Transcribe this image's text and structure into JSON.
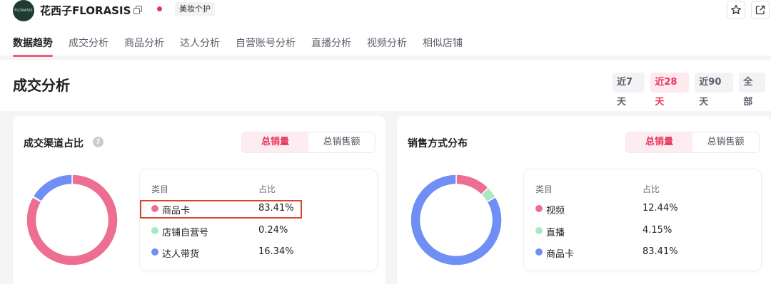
{
  "header": {
    "logo_text": "FLORASIS",
    "shop_name": "花西子FLORASIS",
    "category_badge": "美妆个护",
    "icons": {
      "copy": "copy-icon",
      "live": "live-dot",
      "star": "star-icon",
      "share": "share-icon"
    }
  },
  "tabs": [
    {
      "label": "数据趋势",
      "active": true
    },
    {
      "label": "成交分析"
    },
    {
      "label": "商品分析"
    },
    {
      "label": "达人分析"
    },
    {
      "label": "自营账号分析"
    },
    {
      "label": "直播分析"
    },
    {
      "label": "视频分析"
    },
    {
      "label": "相似店铺"
    }
  ],
  "section": {
    "title": "成交分析",
    "ranges": [
      {
        "label": "近7天"
      },
      {
        "label": "近28天",
        "active": true
      },
      {
        "label": "近90天"
      },
      {
        "label": "全部"
      }
    ]
  },
  "channel_card": {
    "title": "成交渠道占比",
    "help_icon": "?",
    "toggle": [
      {
        "label": "总销量",
        "active": true
      },
      {
        "label": "总销售额"
      }
    ],
    "col_category": "类目",
    "col_share": "占比",
    "rows": [
      {
        "name": "商品卡",
        "share": "83.41%",
        "color": "#ed6e91",
        "highlighted": true
      },
      {
        "name": "店铺自营号",
        "share": "0.24%",
        "color": "#a9e8c5"
      },
      {
        "name": "达人带货",
        "share": "16.34%",
        "color": "#6f8ff5"
      }
    ]
  },
  "method_card": {
    "title": "销售方式分布",
    "toggle": [
      {
        "label": "总销量",
        "active": true
      },
      {
        "label": "总销售额"
      }
    ],
    "col_category": "类目",
    "col_share": "占比",
    "rows": [
      {
        "name": "视频",
        "share": "12.44%",
        "color": "#ed6e91"
      },
      {
        "name": "直播",
        "share": "4.15%",
        "color": "#a9e8c5"
      },
      {
        "name": "商品卡",
        "share": "83.41%",
        "color": "#6f8ff5"
      }
    ]
  },
  "chart_data": [
    {
      "type": "pie",
      "categories": [
        "商品卡",
        "店铺自营号",
        "达人带货"
      ],
      "values": [
        83.41,
        0.24,
        16.34
      ]
    },
    {
      "type": "pie",
      "categories": [
        "视频",
        "直播",
        "商品卡"
      ],
      "values": [
        12.44,
        4.15,
        83.41
      ]
    }
  ]
}
